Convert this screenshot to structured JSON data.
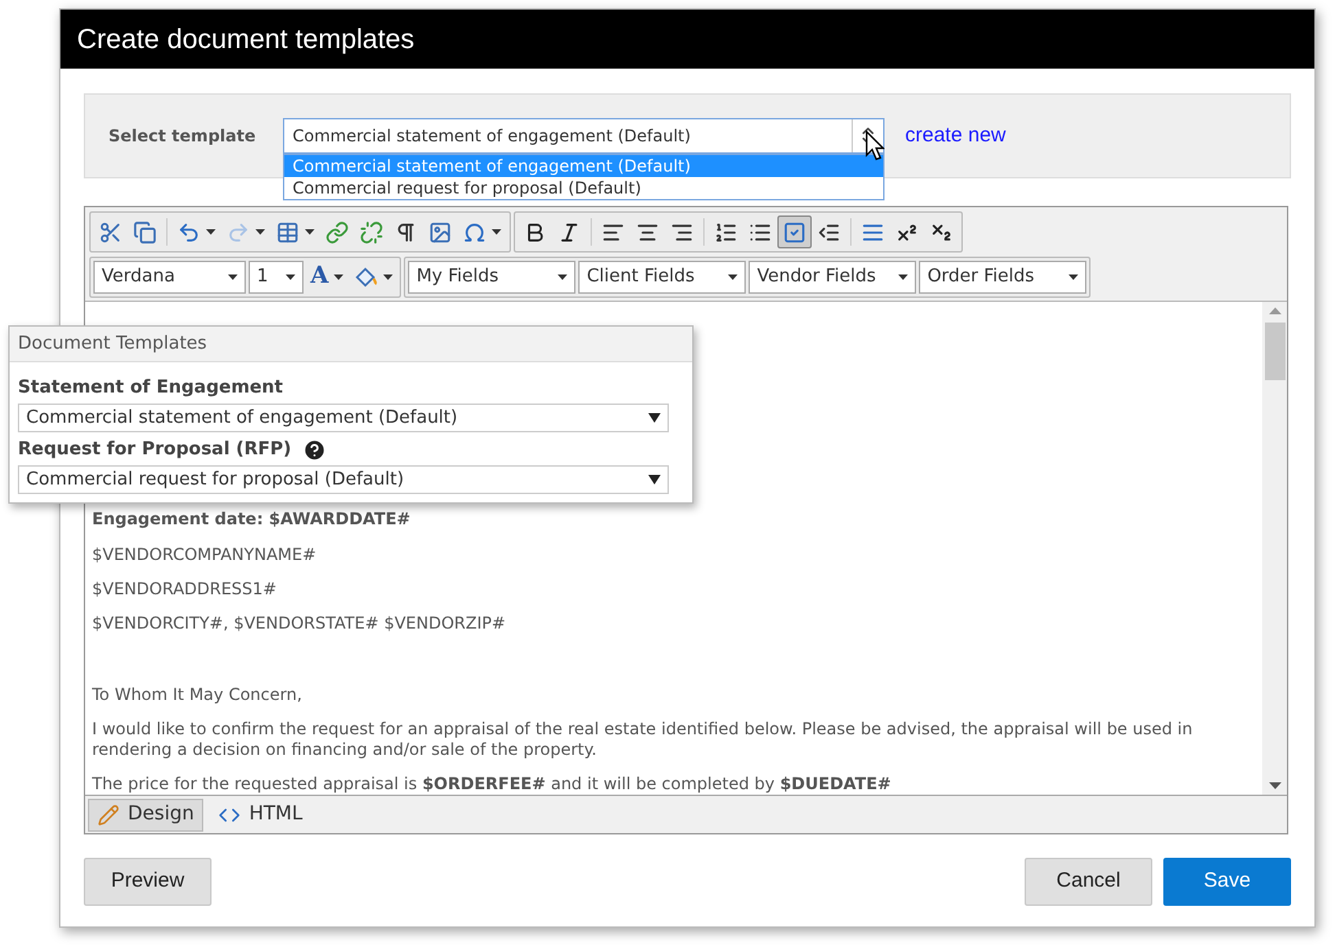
{
  "window": {
    "title": "Create document templates"
  },
  "template_selector": {
    "label": "Select template",
    "value": "Commercial statement of engagement (Default)",
    "expanded": true,
    "options": [
      {
        "label": "Commercial statement of engagement (Default)",
        "selected": true
      },
      {
        "label": "Commercial request for proposal (Default)",
        "selected": false
      }
    ],
    "link": "create new"
  },
  "toolbar": {
    "groups": [
      [
        {
          "kind": "cut",
          "active": false
        },
        {
          "kind": "copy",
          "active": false
        }
      ],
      [
        {
          "kind": "undo",
          "active": false
        },
        {
          "kind": "redo",
          "active": false
        },
        {
          "kind": "table",
          "active": false
        },
        {
          "kind": "link",
          "active": false
        },
        {
          "kind": "unlink",
          "active": false
        },
        {
          "kind": "paragraph",
          "active": false
        },
        {
          "kind": "image",
          "active": false
        },
        {
          "kind": "symbol",
          "active": false
        }
      ],
      [
        {
          "kind": "bold",
          "active": false
        },
        {
          "kind": "italic",
          "active": false
        }
      ],
      [
        {
          "kind": "align_left",
          "active": false
        },
        {
          "kind": "align_center",
          "active": false
        },
        {
          "kind": "align_right",
          "active": false
        }
      ],
      [
        {
          "kind": "ordered_list",
          "active": false
        },
        {
          "kind": "bullet_list",
          "active": false
        },
        {
          "kind": "checkbox",
          "active": true
        },
        {
          "kind": "outdent",
          "active": false
        }
      ],
      [
        {
          "kind": "rule",
          "active": false
        },
        {
          "kind": "superscript",
          "active": false
        },
        {
          "kind": "subscript",
          "active": false
        }
      ]
    ],
    "font": "Verdana",
    "size": "1",
    "font_color_label": "A",
    "field_menus": [
      "My Fields",
      "Client Fields",
      "Vendor Fields",
      "Order Fields"
    ]
  },
  "content": [
    {
      "kind": "bold",
      "text": "Engagement date: $AWARDDATE#"
    },
    {
      "kind": "plain",
      "text": "$VENDORCOMPANYNAME#"
    },
    {
      "kind": "plain",
      "text": "$VENDORADDRESS1#"
    },
    {
      "kind": "plain",
      "text": "$VENDORCITY#, $VENDORSTATE# $VENDORZIP#"
    },
    {
      "kind": "blank"
    },
    {
      "kind": "plain",
      "text": "To Whom It May Concern,"
    },
    {
      "kind": "plain",
      "text": "I would like to confirm the request for an appraisal of the real estate identified below. Please be advised, the appraisal will be used in rendering a decision on financing and/or sale of the property."
    },
    {
      "kind": "plain",
      "text": "The price for the requested appraisal is **$ORDERFEE#** and it will be completed by **$DUEDATE#**"
    }
  ],
  "mode_tabs": [
    {
      "kind": "design",
      "label": "Design",
      "selected": true
    },
    {
      "kind": "html",
      "label": "HTML",
      "selected": false
    }
  ],
  "popup": {
    "title": "Document Templates",
    "groups": [
      {
        "label": "Statement of Engagement",
        "help": false,
        "value": "Commercial statement of engagement (Default)"
      },
      {
        "label": "Request for Proposal (RFP)",
        "help": true,
        "value": "Commercial request for proposal (Default)"
      }
    ]
  },
  "buttons": [
    {
      "kind": "secondary",
      "label": "Preview"
    },
    {
      "kind": "spacer"
    },
    {
      "kind": "secondary",
      "label": "Cancel"
    },
    {
      "kind": "primary",
      "label": "Save"
    }
  ]
}
